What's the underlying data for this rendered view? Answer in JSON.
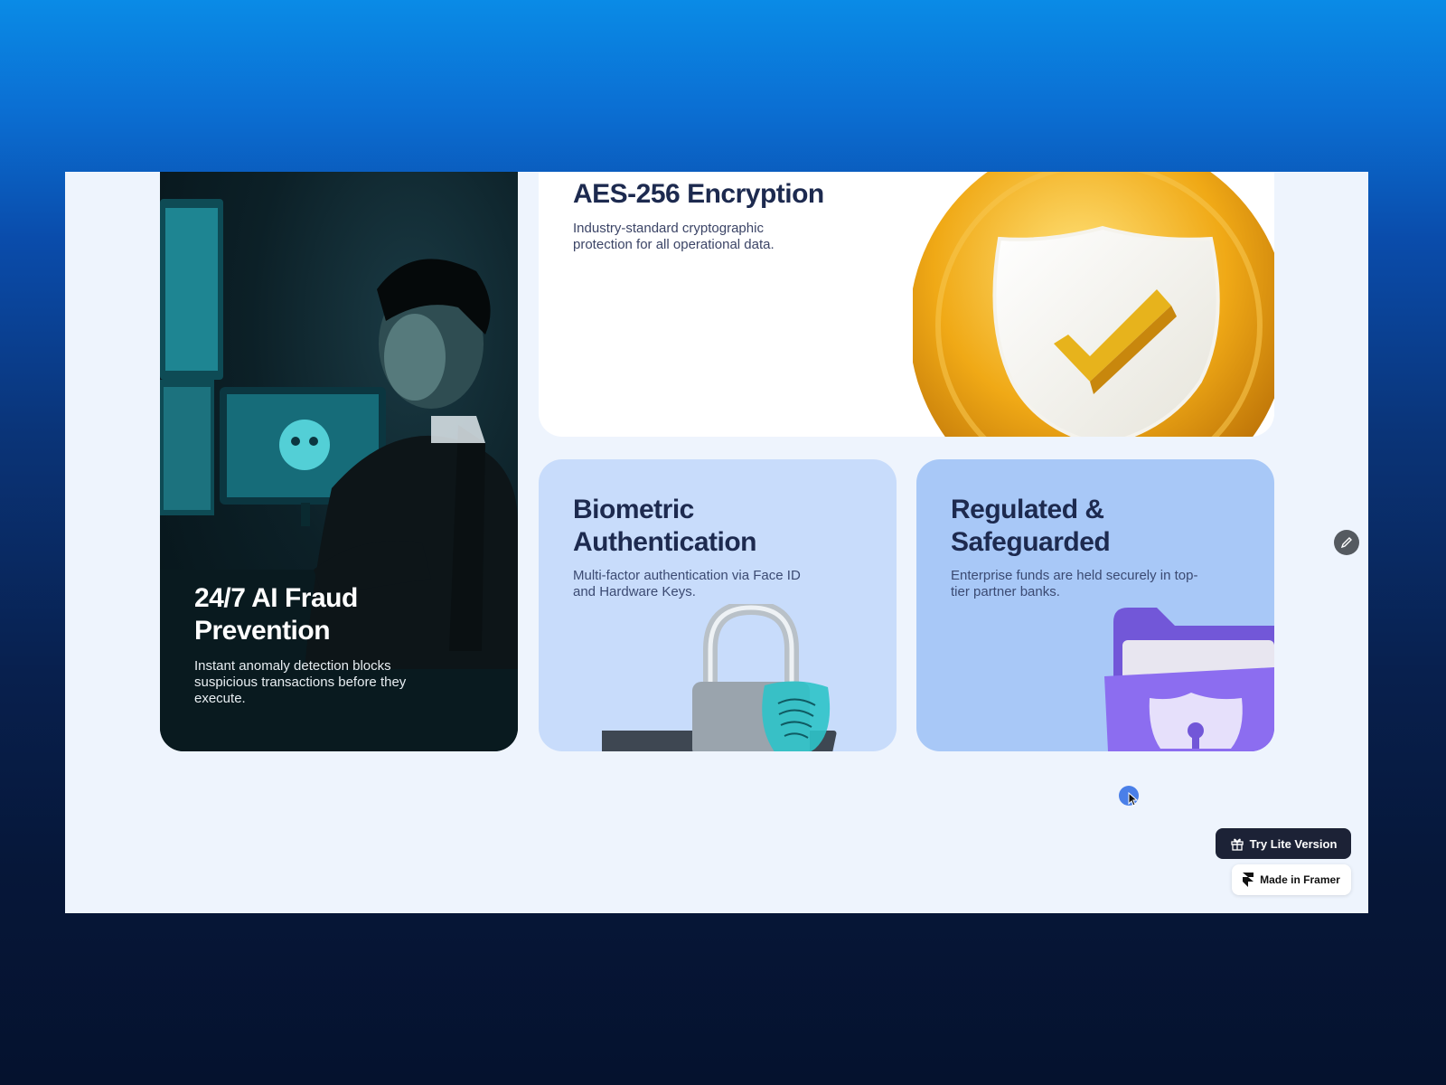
{
  "cards": {
    "fraud": {
      "title": "24/7 AI Fraud Prevention",
      "description": "Instant anomaly detection blocks suspicious transactions before they execute."
    },
    "encryption": {
      "title": "AES-256 Encryption",
      "description": "Industry-standard cryptographic protection for all operational data."
    },
    "biometric": {
      "title": "Biometric Authentication",
      "description": "Multi-factor authentication via Face ID and Hardware Keys."
    },
    "regulated": {
      "title": "Regulated & Safeguarded",
      "description": "Enterprise funds are held securely in top-tier partner banks."
    }
  },
  "badges": {
    "try_lite": "Try Lite Version",
    "made_in_framer": "Made in Framer"
  },
  "icons": {
    "edit": "pencil-icon",
    "gift": "gift-icon",
    "framer": "framer-logo-icon"
  },
  "colors": {
    "page_background": "#0b4fa8",
    "canvas": "#eef4fd",
    "heading": "#1d2a4f",
    "biometric_card": "#c8dcfb",
    "regulated_card": "#a8c8f7",
    "try_button": "#1c2236"
  }
}
